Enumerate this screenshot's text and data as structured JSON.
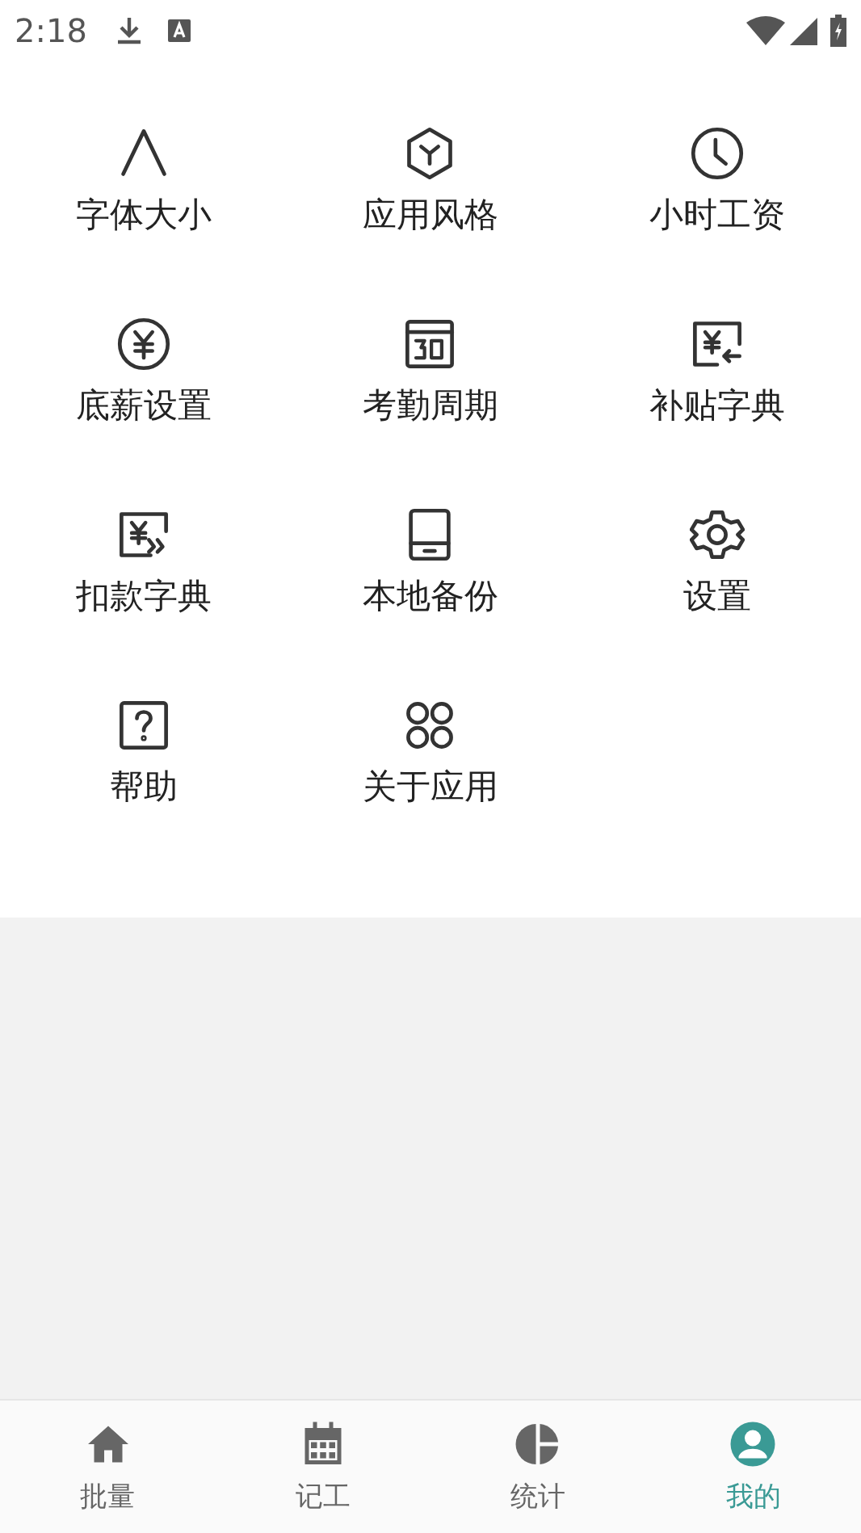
{
  "status_bar": {
    "time": "2:18"
  },
  "menu_items": [
    {
      "label": "字体大小"
    },
    {
      "label": "应用风格"
    },
    {
      "label": "小时工资"
    },
    {
      "label": "底薪设置"
    },
    {
      "label": "考勤周期"
    },
    {
      "label": "补贴字典"
    },
    {
      "label": "扣款字典"
    },
    {
      "label": "本地备份"
    },
    {
      "label": "设置"
    },
    {
      "label": "帮助"
    },
    {
      "label": "关于应用"
    }
  ],
  "bottom_nav": [
    {
      "label": "批量",
      "selected": false
    },
    {
      "label": "记工",
      "selected": false
    },
    {
      "label": "统计",
      "selected": false
    },
    {
      "label": "我的",
      "selected": true
    }
  ]
}
